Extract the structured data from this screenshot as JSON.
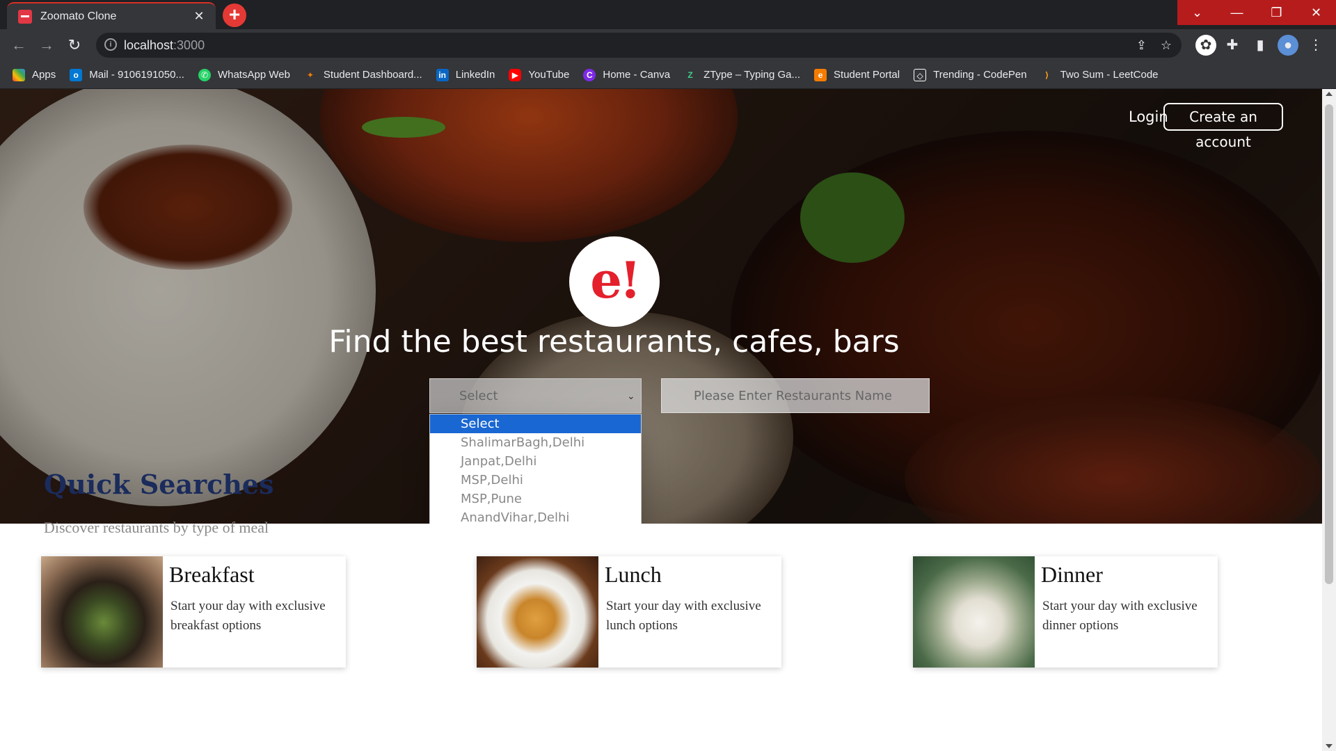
{
  "browser": {
    "tab_title": "Zoomato Clone",
    "url_host": "localhost",
    "url_port": ":3000",
    "bookmarks": [
      {
        "label": "Apps",
        "icon": "apps-grid-icon",
        "color": "#ea4335"
      },
      {
        "label": "Mail - 9106191050...",
        "icon": "outlook-icon",
        "color": "#0078d4"
      },
      {
        "label": "WhatsApp Web",
        "icon": "whatsapp-icon",
        "color": "#25d366"
      },
      {
        "label": "Student Dashboard...",
        "icon": "dashboard-icon",
        "color": "#f57c00"
      },
      {
        "label": "LinkedIn",
        "icon": "linkedin-icon",
        "color": "#0a66c2"
      },
      {
        "label": "YouTube",
        "icon": "youtube-icon",
        "color": "#ff0000"
      },
      {
        "label": "Home - Canva",
        "icon": "canva-icon",
        "color": "#7d2ae8"
      },
      {
        "label": "ZType – Typing Ga...",
        "icon": "ztype-icon",
        "color": "#3ecf8e"
      },
      {
        "label": "Student Portal",
        "icon": "portal-icon",
        "color": "#f57c00"
      },
      {
        "label": "Trending - CodePen",
        "icon": "codepen-icon",
        "color": "#ffffff"
      },
      {
        "label": "Two Sum - LeetCode",
        "icon": "leetcode-icon",
        "color": "#ffa116"
      }
    ]
  },
  "header": {
    "login_label": "Login",
    "signup_label": "Create an account"
  },
  "hero": {
    "logo_text": "e!",
    "headline": "Find the best restaurants, cafes, bars",
    "location_select_value": "Select",
    "search_placeholder": "Please Enter Restaurants Name",
    "location_options": [
      "Select",
      "ShalimarBagh,Delhi",
      "Janpat,Delhi",
      "MSP,Delhi",
      "MSP,Pune",
      "AnandVihar,Delhi"
    ]
  },
  "quick_searches": {
    "title": "Quick Searches",
    "subtitle": "Discover restaurants by type of meal",
    "cards": [
      {
        "title": "Breakfast",
        "description": "Start your day with exclusive breakfast options"
      },
      {
        "title": "Lunch",
        "description": "Start your day with exclusive lunch options"
      },
      {
        "title": "Dinner",
        "description": "Start your day with exclusive dinner options"
      }
    ]
  },
  "colors": {
    "brand_red": "#e4202c",
    "heading_navy": "#1a2b5c",
    "dropdown_highlight": "#1967d2"
  }
}
